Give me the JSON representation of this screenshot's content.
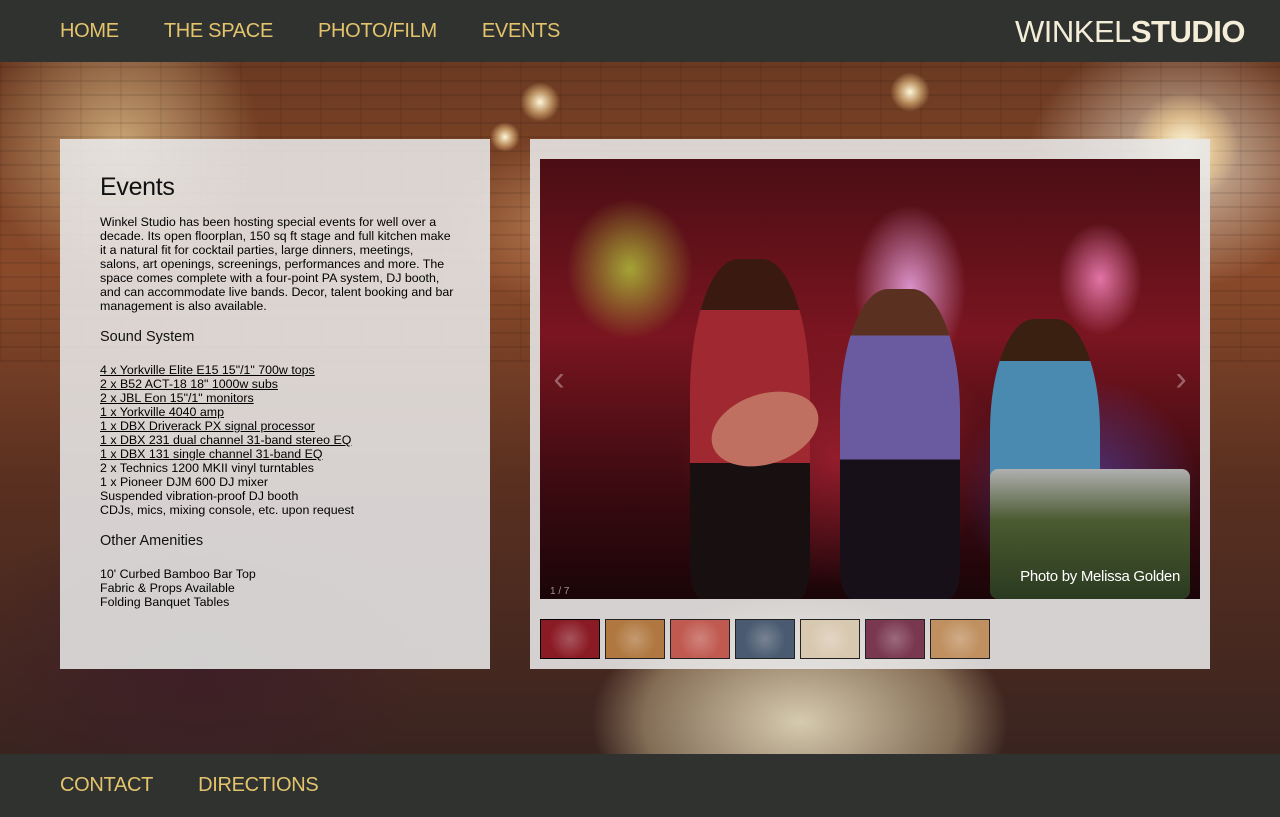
{
  "nav": {
    "items": [
      "HOME",
      "THE SPACE",
      "PHOTO/FILM",
      "EVENTS"
    ]
  },
  "logo": {
    "thin": "WINKEL",
    "bold": "STUDIO"
  },
  "content": {
    "title": "Events",
    "intro": "Winkel Studio has been hosting special events for well over a decade. Its open floorplan, 150 sq ft stage and full kitchen make it a natural fit for cocktail parties, large dinners, meetings, salons, art openings, screenings, performances and more. The space comes complete with a four-point PA system, DJ booth, and can accommodate live bands. Decor, talent booking and bar management is also available.",
    "sound_heading": "Sound System",
    "sound_links": [
      "4 x Yorkville Elite E15 15\"/1\" 700w tops",
      "2 x B52 ACT-18 18\" 1000w subs",
      "2 x JBL Eon 15\"/1\" monitors",
      "1 x Yorkville 4040 amp",
      "1 x DBX Driverack PX signal processor",
      "1 x DBX 231 dual channel 31-band stereo EQ",
      "1 x DBX 131 single channel 31-band EQ"
    ],
    "sound_plain": [
      "2 x Technics 1200 MKII vinyl turntables",
      "1 x Pioneer DJM 600 DJ mixer",
      "Suspended vibration-proof DJ booth",
      "CDJs, mics, mixing console, etc. upon request"
    ],
    "amenities_heading": "Other Amenities",
    "amenities": [
      "10' Curbed Bamboo Bar Top",
      "Fabric & Props Available",
      "Folding Banquet Tables"
    ]
  },
  "gallery": {
    "counter": "1 / 7",
    "credit": "Photo by Melissa Golden",
    "prev_icon": "chevron-left-icon",
    "next_icon": "chevron-right-icon",
    "thumb_colors": [
      "#8a1a24",
      "#b07840",
      "#c05a50",
      "#4a5a70",
      "#d8c8b0",
      "#7a3850",
      "#c09060"
    ]
  },
  "footer": {
    "items": [
      "CONTACT",
      "DIRECTIONS"
    ]
  },
  "colors": {
    "nav_text": "#e3c46d",
    "bar_bg": "#303230"
  }
}
